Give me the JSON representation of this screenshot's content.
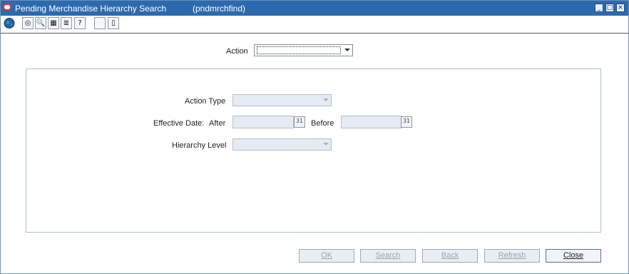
{
  "window": {
    "title": "Pending Merchandise Hierarchy Search",
    "form_name": "(pndmrchfind)",
    "controls": {
      "minimize": "_",
      "maximize": "□",
      "close": "×"
    }
  },
  "toolbar": {
    "icons": [
      "globe-icon",
      "help-icon",
      "find-icon",
      "calendar-icon",
      "notes-icon",
      "question-icon",
      "blank-icon",
      "document-icon"
    ],
    "glyphs": {
      "help": "◎",
      "find": "🔍",
      "calendar": "▦",
      "notes": "≣",
      "question": "?",
      "blank": "",
      "document": "▯"
    }
  },
  "action": {
    "label": "Action",
    "value": ""
  },
  "criteria": {
    "action_type_label": "Action Type",
    "action_type_value": "",
    "effective_date_label": "Effective Date:",
    "after_label": "After",
    "after_value": "",
    "before_label": "Before",
    "before_value": "",
    "calendar_glyph": "31",
    "hierarchy_level_label": "Hierarchy Level",
    "hierarchy_level_value": ""
  },
  "buttons": {
    "ok": "OK",
    "search": "Search",
    "back": "Back",
    "refresh": "Refresh",
    "close": "Close"
  },
  "colors": {
    "titlebar": "#2c6aaf",
    "disabled_field": "#e4ebf3"
  }
}
